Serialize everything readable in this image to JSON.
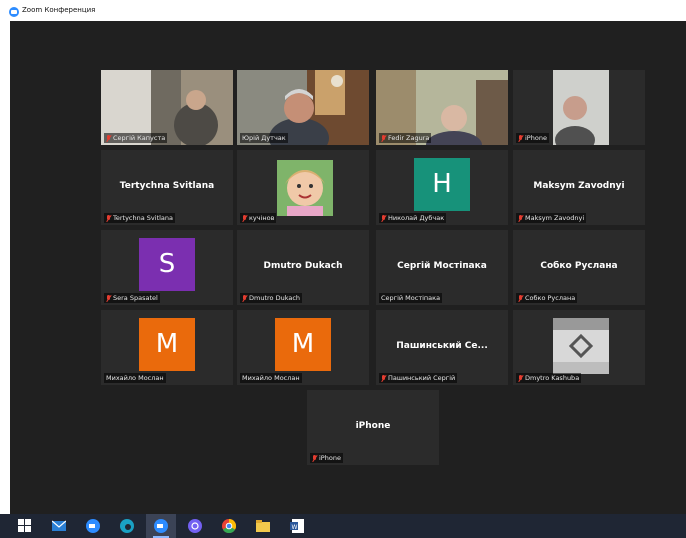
{
  "window": {
    "title": "Zoom Конференция"
  },
  "participants": [
    {
      "name": "Сергій Капуста",
      "muted": true,
      "view": "video"
    },
    {
      "name": "Юрій Дутчак",
      "muted": false,
      "view": "video",
      "active_speaker": true
    },
    {
      "name": "Fedir Zagura",
      "muted": true,
      "view": "video"
    },
    {
      "name": "iPhone",
      "muted": true,
      "view": "video"
    },
    {
      "name": "Tertychna Svitlana",
      "display": "Tertychna Svitlana",
      "muted": true,
      "view": "name"
    },
    {
      "name": "кучінов",
      "muted": true,
      "view": "photo"
    },
    {
      "name": "Николай Дубчак",
      "initial": "H",
      "muted": true,
      "view": "avatar",
      "color": "#17927a"
    },
    {
      "name": "Maksym Zavodnyi",
      "display": "Maksym Zavodnyi",
      "muted": true,
      "view": "name"
    },
    {
      "name": "Sera Spasatel",
      "initial": "S",
      "muted": true,
      "view": "avatar",
      "color": "#7b2fb0"
    },
    {
      "name": "Dmutro Dukach",
      "display": "Dmutro Dukach",
      "muted": true,
      "view": "name"
    },
    {
      "name": "Сергій Мостіпака",
      "display": "Сергій Мостіпака",
      "muted": false,
      "view": "name"
    },
    {
      "name": "Собко Руслана",
      "display": "Собко Руслана",
      "muted": true,
      "view": "name"
    },
    {
      "name": "Михайло Мослан",
      "initial": "M",
      "muted": false,
      "view": "avatar",
      "color": "#ea6a0c"
    },
    {
      "name": "Михайло Мослан",
      "initial": "M",
      "muted": false,
      "view": "avatar",
      "color": "#ea6a0c"
    },
    {
      "name": "Пашинський Сергій",
      "display": "Пашинський Се...",
      "muted": true,
      "view": "name"
    },
    {
      "name": "Dmytro Kashuba",
      "muted": true,
      "view": "photo"
    },
    {
      "name": "iPhone",
      "display": "iPhone",
      "muted": true,
      "view": "name"
    }
  ],
  "taskbar": [
    {
      "icon": "windows-start-icon"
    },
    {
      "icon": "mail-icon"
    },
    {
      "icon": "zoom-meetings-icon"
    },
    {
      "icon": "edge-browser-icon"
    },
    {
      "icon": "zoom-active-icon",
      "active": true
    },
    {
      "icon": "viber-icon"
    },
    {
      "icon": "chrome-icon"
    },
    {
      "icon": "file-explorer-icon"
    },
    {
      "icon": "word-icon"
    }
  ]
}
